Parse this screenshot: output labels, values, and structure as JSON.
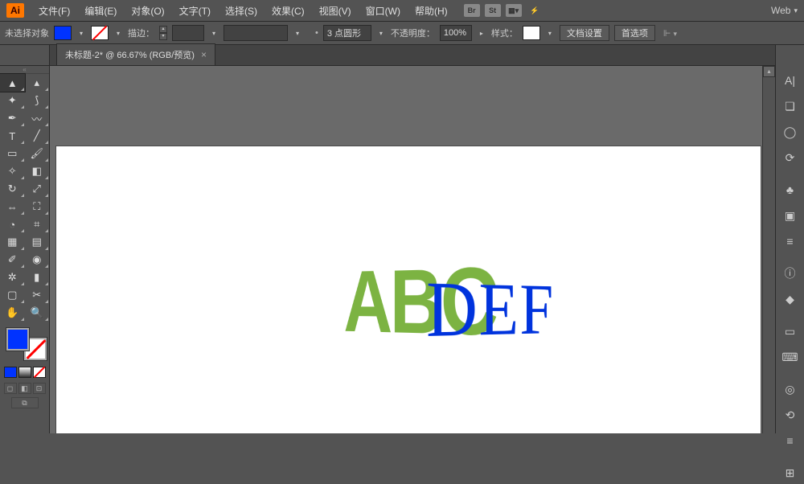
{
  "menubar": {
    "items": [
      "文件(F)",
      "编辑(E)",
      "对象(O)",
      "文字(T)",
      "选择(S)",
      "效果(C)",
      "视图(V)",
      "窗口(W)",
      "帮助(H)"
    ],
    "icons": [
      "Br",
      "St"
    ],
    "workspace": "Web"
  },
  "optionsbar": {
    "selection": "未选择对象",
    "stroke_label": "描边：",
    "stroke_weight": "",
    "brush_profile": "",
    "cap_value": "3 点圆形",
    "opacity_label": "不透明度：",
    "opacity_value": "100%",
    "style_label": "样式：",
    "doc_setup": "文档设置",
    "preferences": "首选项"
  },
  "tab": {
    "title": "未标题-2* @ 66.67% (RGB/预览)"
  },
  "canvas": {
    "text1": "ABC",
    "text2": "DEF"
  },
  "toolbox": {
    "tools": [
      {
        "n": "selection-tool",
        "g": "▲",
        "a": true
      },
      {
        "n": "direct-selection-tool",
        "g": "▴"
      },
      {
        "n": "magic-wand-tool",
        "g": "✦"
      },
      {
        "n": "lasso-tool",
        "g": "⟆"
      },
      {
        "n": "pen-tool",
        "g": "✒"
      },
      {
        "n": "curvature-tool",
        "g": "〰"
      },
      {
        "n": "type-tool",
        "g": "T"
      },
      {
        "n": "line-tool",
        "g": "╱"
      },
      {
        "n": "rectangle-tool",
        "g": "▭"
      },
      {
        "n": "paintbrush-tool",
        "g": "🖌"
      },
      {
        "n": "shaper-tool",
        "g": "✧"
      },
      {
        "n": "eraser-tool",
        "g": "◧"
      },
      {
        "n": "rotate-tool",
        "g": "↻"
      },
      {
        "n": "scale-tool",
        "g": "⤢"
      },
      {
        "n": "width-tool",
        "g": "⇔"
      },
      {
        "n": "free-transform-tool",
        "g": "⛶"
      },
      {
        "n": "shape-builder-tool",
        "g": "◔"
      },
      {
        "n": "perspective-grid-tool",
        "g": "⌗"
      },
      {
        "n": "mesh-tool",
        "g": "▦"
      },
      {
        "n": "gradient-tool",
        "g": "▤"
      },
      {
        "n": "eyedropper-tool",
        "g": "✐"
      },
      {
        "n": "blend-tool",
        "g": "◉"
      },
      {
        "n": "symbol-sprayer-tool",
        "g": "✲"
      },
      {
        "n": "column-graph-tool",
        "g": "▮"
      },
      {
        "n": "artboard-tool",
        "g": "▢"
      },
      {
        "n": "slice-tool",
        "g": "✂"
      },
      {
        "n": "hand-tool",
        "g": "✋"
      },
      {
        "n": "zoom-tool",
        "g": "🔍"
      }
    ]
  },
  "panels": {
    "icons": [
      "A|",
      "❏",
      "◯",
      "⟳",
      "",
      "♣",
      "▣",
      "≡",
      "",
      "ⓘ",
      "◆",
      "",
      "▭",
      "⌨",
      "",
      "◎",
      "⟲",
      "≡",
      "",
      "⊞"
    ]
  }
}
